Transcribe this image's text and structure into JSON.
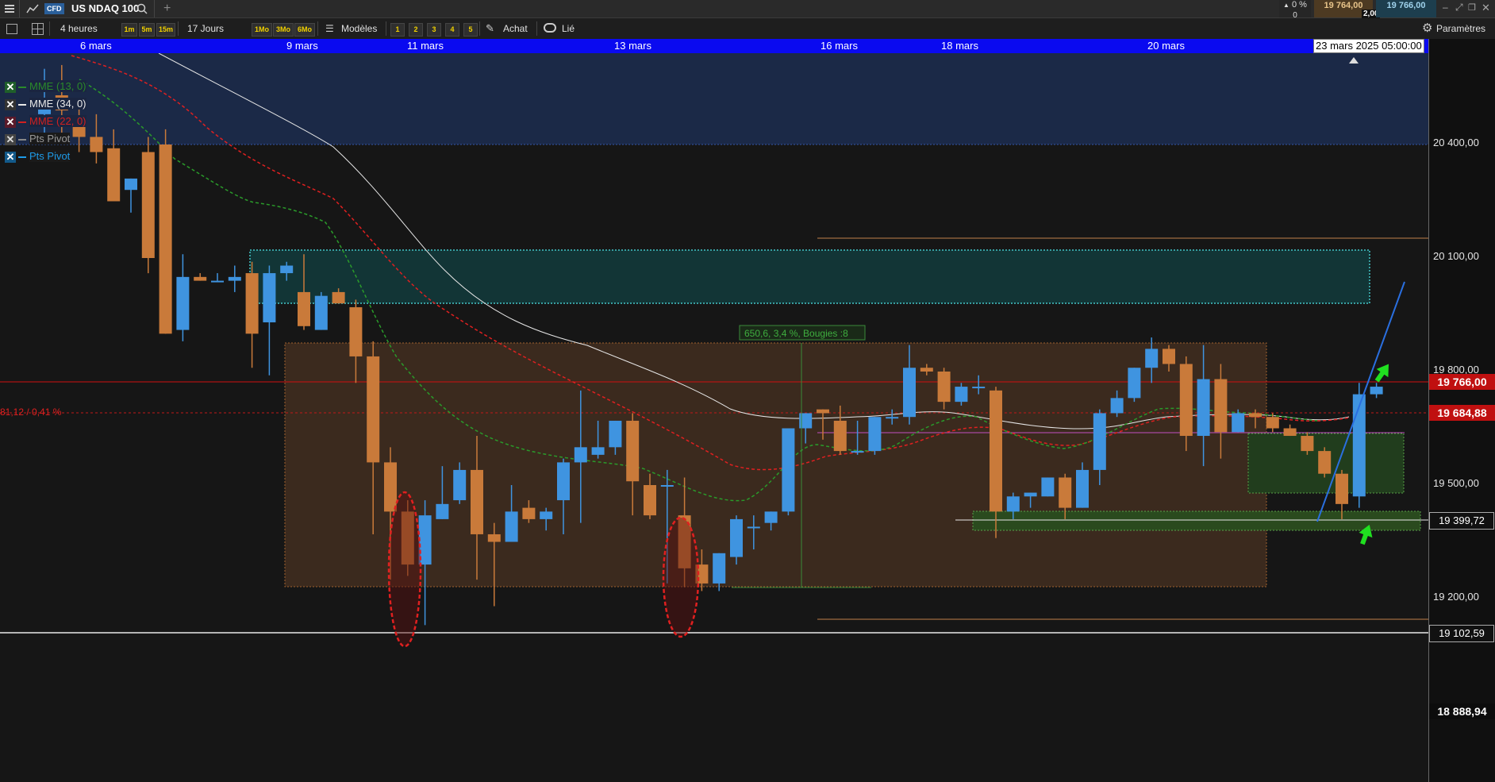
{
  "topbar": {
    "menu_icon": "hamburger-icon",
    "chart_icon": "line-chart-icon",
    "badge": "CFD",
    "symbol": "US NDAQ 100",
    "search_icon": "search-icon",
    "add_icon": "plus-icon",
    "change_pct": "0 %",
    "change_abs": "0",
    "bid": "19 764,00",
    "spread": "2,00",
    "ask": "19 766,00"
  },
  "toolbar": {
    "period": "4 heures",
    "timeframes": [
      "1m",
      "5m",
      "15m"
    ],
    "range": "17 Jours",
    "spans": [
      "1Mo",
      "3Mo",
      "6Mo"
    ],
    "models": "Modèles",
    "layouts": [
      "1",
      "2",
      "3",
      "4",
      "5"
    ],
    "buy": "Achat",
    "linked": "Lié",
    "settings": "Paramètres"
  },
  "dates": [
    "6 mars",
    "9 mars",
    "11 mars",
    "13 mars",
    "16 mars",
    "18 mars",
    "20 mars"
  ],
  "cursor_date": "23 mars 2025 05:00:00",
  "axis_ticks": [
    "20 400,00",
    "20 100,00",
    "19 800,00",
    "19 500,00",
    "19 200,00"
  ],
  "price_labels": {
    "last": "19 766,00",
    "mark": "19 684,88",
    "support_high": "19 399,72",
    "support_low": "19 102,59",
    "bottom": "18 888,94"
  },
  "left_readout": "81,12 / 0,41 %",
  "measure_label": "650,6, 3,4 %, Bougies :8",
  "legend": [
    {
      "label": "MME (13, 0)",
      "color": "#2a8a2a"
    },
    {
      "label": "MME (34, 0)",
      "color": "#e8e8e8"
    },
    {
      "label": "MME (22, 0)",
      "color": "#d02020"
    },
    {
      "label": "Pts Pivot",
      "color": "#999999"
    },
    {
      "label": "Pts Pivot",
      "color": "#1e9be8"
    }
  ],
  "colors": {
    "bull": "#3f94e0",
    "bear": "#c97a3a",
    "date_bar": "#0a0af0",
    "last_price": "#d01010"
  },
  "chart_data": {
    "type": "candlestick",
    "ylim": [
      18888.94,
      20470
    ],
    "candles": [
      {
        "o": 20480,
        "h": 20600,
        "l": 20420,
        "c": 20520
      },
      {
        "o": 20530,
        "h": 20610,
        "l": 20430,
        "c": 20490
      },
      {
        "o": 20460,
        "h": 20510,
        "l": 20380,
        "c": 20420
      },
      {
        "o": 20420,
        "h": 20480,
        "l": 20350,
        "c": 20380
      },
      {
        "o": 20390,
        "h": 20440,
        "l": 20320,
        "c": 20250
      },
      {
        "o": 20280,
        "h": 20300,
        "l": 20220,
        "c": 20310
      },
      {
        "o": 20380,
        "h": 20420,
        "l": 20060,
        "c": 20100
      },
      {
        "o": 20400,
        "h": 20440,
        "l": 19930,
        "c": 19900
      },
      {
        "o": 19910,
        "h": 20110,
        "l": 19880,
        "c": 20050
      },
      {
        "o": 20050,
        "h": 20060,
        "l": 20040,
        "c": 20040
      },
      {
        "o": 20040,
        "h": 20060,
        "l": 20040,
        "c": 20040
      },
      {
        "o": 20040,
        "h": 20080,
        "l": 20010,
        "c": 20050
      },
      {
        "o": 20060,
        "h": 20090,
        "l": 19810,
        "c": 19900
      },
      {
        "o": 19930,
        "h": 20080,
        "l": 19790,
        "c": 20060
      },
      {
        "o": 20060,
        "h": 20090,
        "l": 20040,
        "c": 20080
      },
      {
        "o": 20010,
        "h": 20110,
        "l": 19910,
        "c": 19920
      },
      {
        "o": 19910,
        "h": 20010,
        "l": 19920,
        "c": 20000
      },
      {
        "o": 20010,
        "h": 20020,
        "l": 19980,
        "c": 19980
      },
      {
        "o": 19970,
        "h": 19990,
        "l": 19770,
        "c": 19840
      },
      {
        "o": 19840,
        "h": 19880,
        "l": 19370,
        "c": 19560
      },
      {
        "o": 19560,
        "h": 19600,
        "l": 19250,
        "c": 19430
      },
      {
        "o": 19430,
        "h": 19460,
        "l": 19260,
        "c": 19290
      },
      {
        "o": 19290,
        "h": 19460,
        "l": 19130,
        "c": 19420
      },
      {
        "o": 19410,
        "h": 19550,
        "l": 19420,
        "c": 19450
      },
      {
        "o": 19460,
        "h": 19560,
        "l": 19450,
        "c": 19540
      },
      {
        "o": 19540,
        "h": 19630,
        "l": 19250,
        "c": 19370
      },
      {
        "o": 19370,
        "h": 19400,
        "l": 19180,
        "c": 19350
      },
      {
        "o": 19350,
        "h": 19500,
        "l": 19360,
        "c": 19430
      },
      {
        "o": 19440,
        "h": 19460,
        "l": 19400,
        "c": 19410
      },
      {
        "o": 19410,
        "h": 19440,
        "l": 19380,
        "c": 19430
      },
      {
        "o": 19460,
        "h": 19570,
        "l": 19370,
        "c": 19560
      },
      {
        "o": 19560,
        "h": 19750,
        "l": 19400,
        "c": 19600
      },
      {
        "o": 19580,
        "h": 19670,
        "l": 19570,
        "c": 19600
      },
      {
        "o": 19600,
        "h": 19670,
        "l": 19580,
        "c": 19670
      },
      {
        "o": 19670,
        "h": 19690,
        "l": 19420,
        "c": 19510
      },
      {
        "o": 19500,
        "h": 19530,
        "l": 19410,
        "c": 19420
      },
      {
        "o": 19500,
        "h": 19540,
        "l": 19240,
        "c": 19500
      },
      {
        "o": 19420,
        "h": 19520,
        "l": 19230,
        "c": 19280
      },
      {
        "o": 19290,
        "h": 19330,
        "l": 19220,
        "c": 19240
      },
      {
        "o": 19240,
        "h": 19320,
        "l": 19220,
        "c": 19320
      },
      {
        "o": 19310,
        "h": 19420,
        "l": 19290,
        "c": 19410
      },
      {
        "o": 19390,
        "h": 19420,
        "l": 19330,
        "c": 19390
      },
      {
        "o": 19400,
        "h": 19430,
        "l": 19380,
        "c": 19430
      },
      {
        "o": 19430,
        "h": 19650,
        "l": 19420,
        "c": 19650
      },
      {
        "o": 19650,
        "h": 19690,
        "l": 19610,
        "c": 19690
      },
      {
        "o": 19700,
        "h": 19650,
        "l": 19620,
        "c": 19690
      },
      {
        "o": 19670,
        "h": 19710,
        "l": 19580,
        "c": 19590
      },
      {
        "o": 19590,
        "h": 19670,
        "l": 19580,
        "c": 19590
      },
      {
        "o": 19590,
        "h": 19660,
        "l": 19580,
        "c": 19680
      },
      {
        "o": 19680,
        "h": 19700,
        "l": 19660,
        "c": 19680
      },
      {
        "o": 19680,
        "h": 19870,
        "l": 19660,
        "c": 19810
      },
      {
        "o": 19810,
        "h": 19820,
        "l": 19790,
        "c": 19800
      },
      {
        "o": 19800,
        "h": 19810,
        "l": 19700,
        "c": 19720
      },
      {
        "o": 19720,
        "h": 19770,
        "l": 19710,
        "c": 19760
      },
      {
        "o": 19760,
        "h": 19790,
        "l": 19740,
        "c": 19760
      },
      {
        "o": 19750,
        "h": 19760,
        "l": 19360,
        "c": 19430
      },
      {
        "o": 19430,
        "h": 19480,
        "l": 19410,
        "c": 19470
      },
      {
        "o": 19470,
        "h": 19480,
        "l": 19440,
        "c": 19480
      },
      {
        "o": 19470,
        "h": 19520,
        "l": 19470,
        "c": 19520
      },
      {
        "o": 19520,
        "h": 19530,
        "l": 19410,
        "c": 19440
      },
      {
        "o": 19440,
        "h": 19560,
        "l": 19440,
        "c": 19540
      },
      {
        "o": 19540,
        "h": 19700,
        "l": 19500,
        "c": 19690
      },
      {
        "o": 19690,
        "h": 19750,
        "l": 19680,
        "c": 19730
      },
      {
        "o": 19730,
        "h": 19800,
        "l": 19720,
        "c": 19810
      },
      {
        "o": 19810,
        "h": 19890,
        "l": 19770,
        "c": 19860
      },
      {
        "o": 19860,
        "h": 19870,
        "l": 19800,
        "c": 19820
      },
      {
        "o": 19820,
        "h": 19840,
        "l": 19590,
        "c": 19630
      },
      {
        "o": 19630,
        "h": 19870,
        "l": 19550,
        "c": 19780
      },
      {
        "o": 19780,
        "h": 19820,
        "l": 19570,
        "c": 19640
      },
      {
        "o": 19640,
        "h": 19700,
        "l": 19650,
        "c": 19690
      },
      {
        "o": 19690,
        "h": 19700,
        "l": 19650,
        "c": 19680
      },
      {
        "o": 19680,
        "h": 19690,
        "l": 19640,
        "c": 19650
      },
      {
        "o": 19650,
        "h": 19660,
        "l": 19630,
        "c": 19630
      },
      {
        "o": 19630,
        "h": 19640,
        "l": 19580,
        "c": 19590
      },
      {
        "o": 19590,
        "h": 19600,
        "l": 19520,
        "c": 19530
      },
      {
        "o": 19530,
        "h": 19540,
        "l": 19410,
        "c": 19450
      },
      {
        "o": 19470,
        "h": 19770,
        "l": 19440,
        "c": 19740
      },
      {
        "o": 19740,
        "h": 19770,
        "l": 19730,
        "c": 19760
      }
    ]
  }
}
